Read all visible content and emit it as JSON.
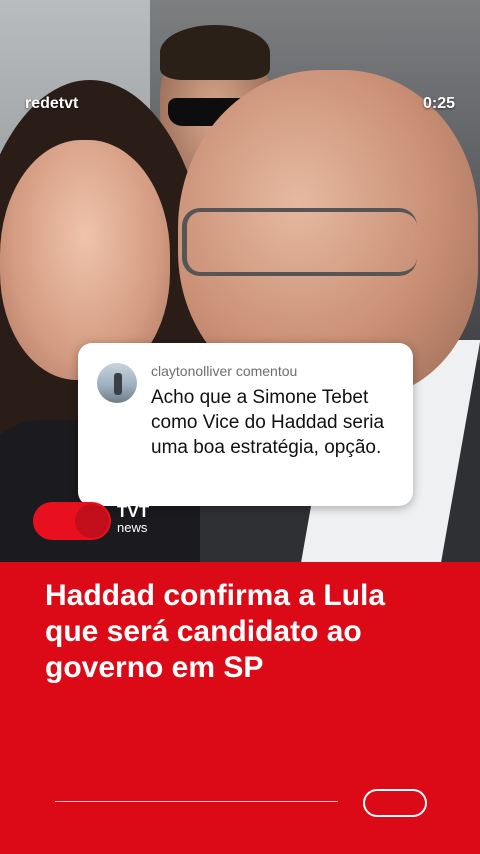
{
  "video": {
    "channel": "redetvt",
    "time": "0:25"
  },
  "comment": {
    "user": "claytonolliver comentou",
    "text": "Acho que a Simone Tebet como Vice do Haddad seria uma boa estratégia, opção."
  },
  "logo": {
    "name": "TVT",
    "sub": "news"
  },
  "headline": "Haddad confirma a Lula que será candidato ao governo em SP",
  "colors": {
    "accent": "#db0a16",
    "logo_red": "#e8101f"
  }
}
